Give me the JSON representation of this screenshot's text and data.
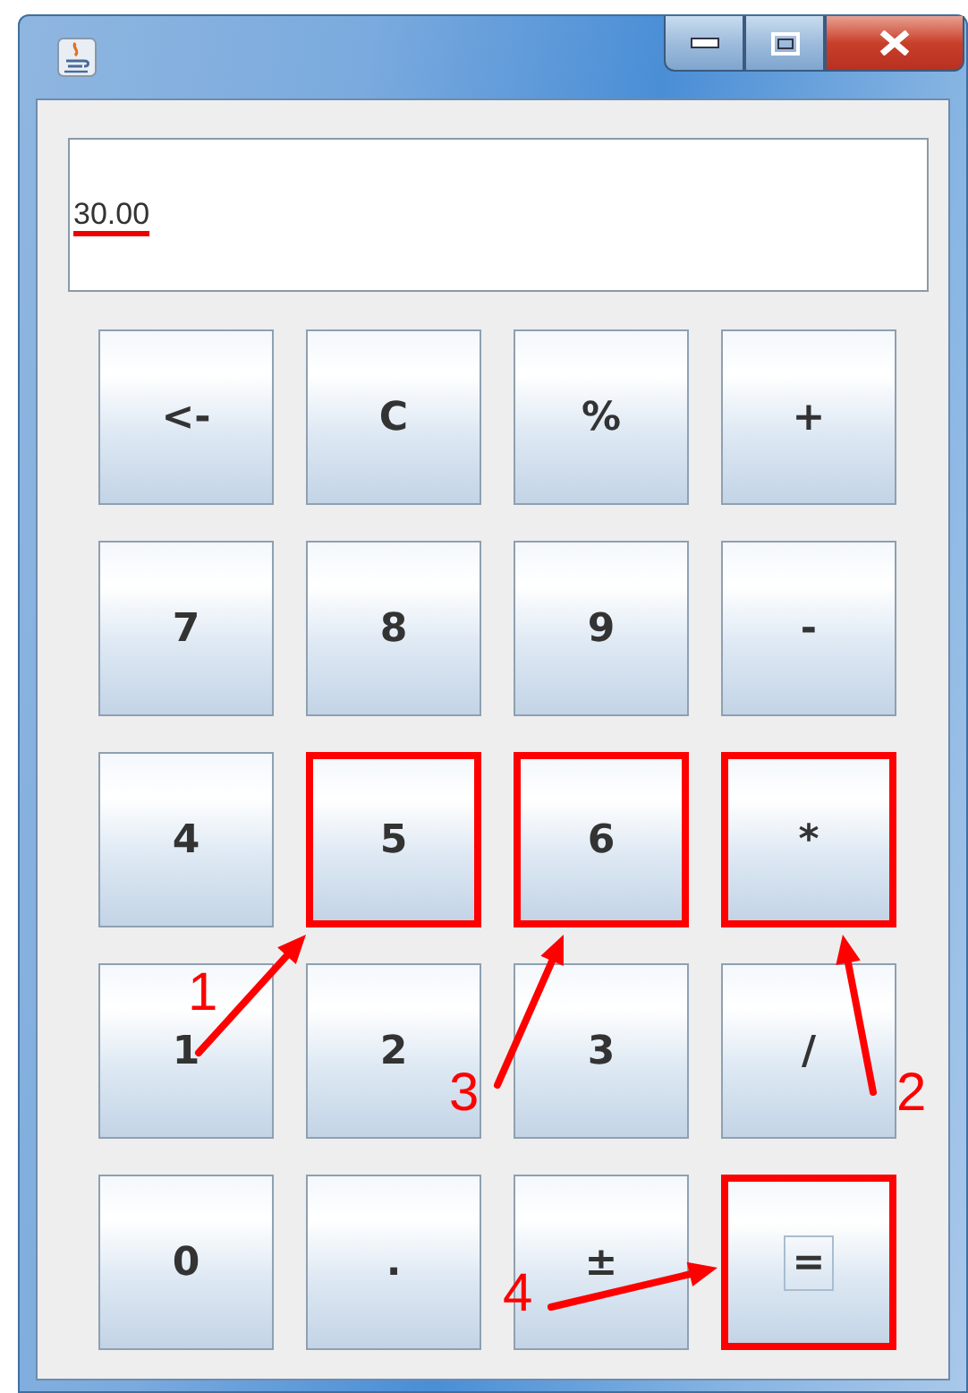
{
  "display": {
    "value": "30.00",
    "underlined": true
  },
  "buttons": [
    {
      "label": "<-",
      "highlighted": false,
      "focused": false
    },
    {
      "label": "C",
      "highlighted": false,
      "focused": false
    },
    {
      "label": "%",
      "highlighted": false,
      "focused": false
    },
    {
      "label": "+",
      "highlighted": false,
      "focused": false
    },
    {
      "label": "7",
      "highlighted": false,
      "focused": false
    },
    {
      "label": "8",
      "highlighted": false,
      "focused": false
    },
    {
      "label": "9",
      "highlighted": false,
      "focused": false
    },
    {
      "label": "-",
      "highlighted": false,
      "focused": false
    },
    {
      "label": "4",
      "highlighted": false,
      "focused": false
    },
    {
      "label": "5",
      "highlighted": true,
      "focused": false
    },
    {
      "label": "6",
      "highlighted": true,
      "focused": false
    },
    {
      "label": "*",
      "highlighted": true,
      "focused": false
    },
    {
      "label": "1",
      "highlighted": false,
      "focused": false
    },
    {
      "label": "2",
      "highlighted": false,
      "focused": false
    },
    {
      "label": "3",
      "highlighted": false,
      "focused": false
    },
    {
      "label": "/",
      "highlighted": false,
      "focused": false
    },
    {
      "label": "0",
      "highlighted": false,
      "focused": false
    },
    {
      "label": ".",
      "highlighted": false,
      "focused": false
    },
    {
      "label": "±",
      "highlighted": false,
      "focused": false
    },
    {
      "label": "=",
      "highlighted": true,
      "focused": true
    }
  ],
  "annotations": [
    {
      "label": "1"
    },
    {
      "label": "2"
    },
    {
      "label": "3"
    },
    {
      "label": "4"
    }
  ]
}
